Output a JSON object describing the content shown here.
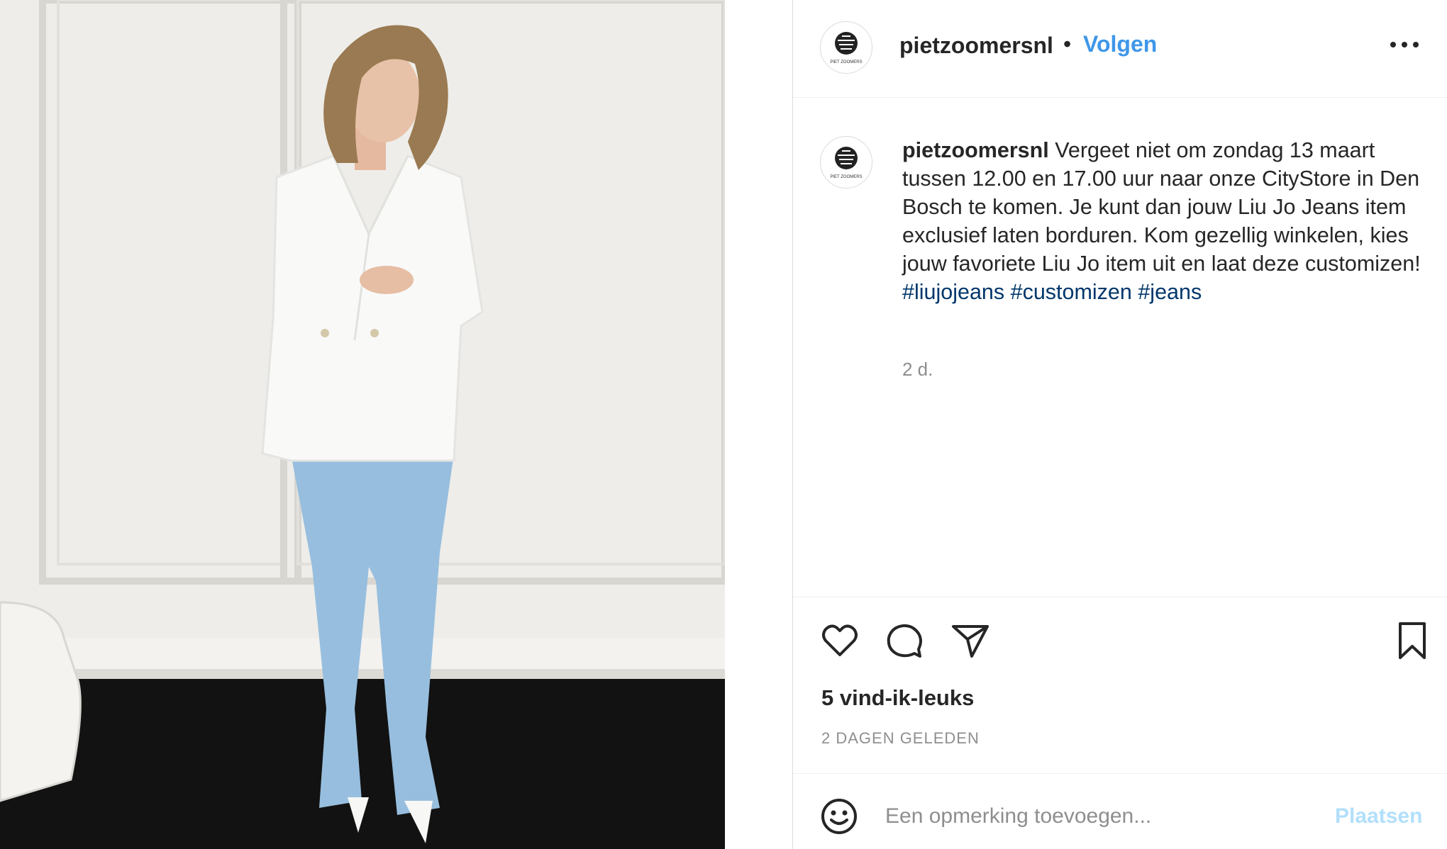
{
  "header": {
    "username": "pietzoomersnl",
    "separator": "•",
    "follow_label": "Volgen",
    "avatar_text": "PIET ZOOMERS"
  },
  "caption": {
    "username": "pietzoomersnl",
    "text": "Vergeet niet om zondag 13 maart tussen 12.00 en 17.00 uur naar onze CityStore in Den Bosch te komen. Je kunt dan jouw Liu Jo Jeans item exclusief laten borduren. Kom gezellig winkelen, kies jouw favoriete Liu Jo item uit en laat deze customizen!",
    "hashtags": [
      "#liujojeans",
      "#customizen",
      "#jeans"
    ],
    "age": "2 d."
  },
  "actions": {
    "likes": "5 vind-ik-leuks",
    "date": "2 DAGEN GELEDEN"
  },
  "comment": {
    "placeholder": "Een opmerking toevoegen...",
    "post_label": "Plaatsen"
  },
  "colors": {
    "link_blue": "#3f97e9",
    "hashtag": "#00376b",
    "muted": "#8e8e8e",
    "post_disabled": "#b2dffc"
  }
}
